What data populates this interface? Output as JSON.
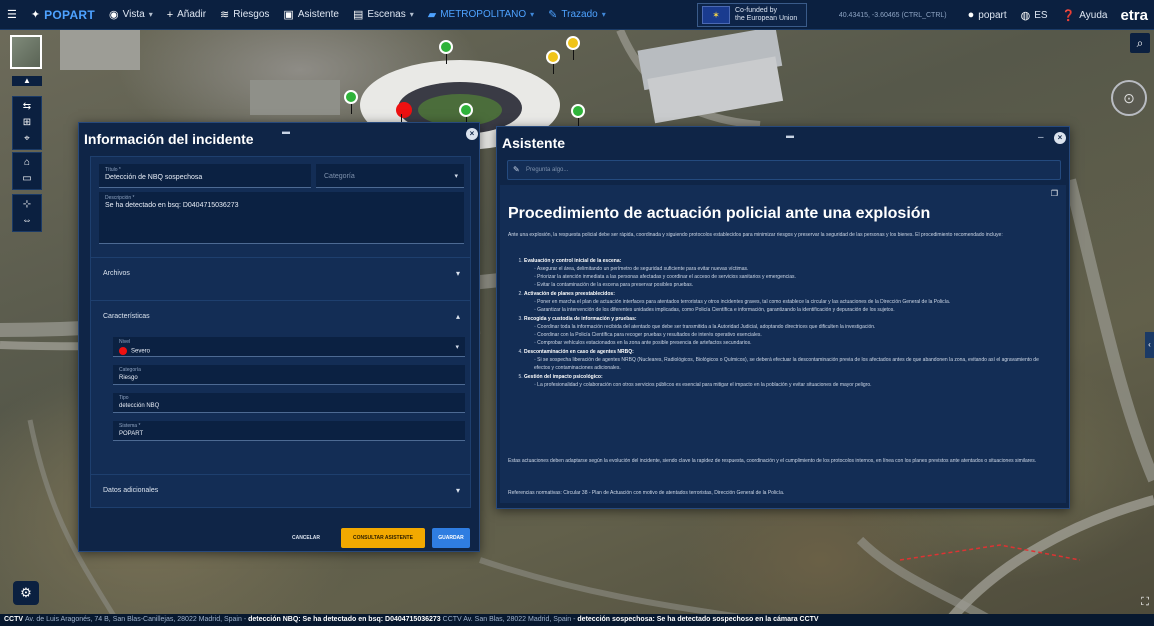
{
  "toolbar": {
    "brand": "POPART",
    "menus": [
      "Vista",
      "Añadir",
      "Riesgos",
      "Asistente",
      "Escenas"
    ],
    "layer_select": "METROPOLITANO",
    "draw_menu": "Trazado",
    "eu_text_1": "Co-funded by",
    "eu_text_2": "the European Union",
    "coords": "40.43415, -3.60465 (CTRL_CTRL)",
    "user": "popart",
    "lang": "ES",
    "help": "Ayuda",
    "logo": "etra"
  },
  "incident": {
    "title": "Información del incidente",
    "type_label": "Título *",
    "type_value": "Detección de NBQ sospechosa",
    "category_placeholder": "Categoría",
    "desc_label": "Descripción *",
    "desc_value": "Se ha detectado en bsq: D0404715036273",
    "section_files": "Archivos",
    "section_features": "Características",
    "severity_label": "Nivel",
    "severity_value": "Severo",
    "category_label": "Categoría",
    "category_value": "Riesgo",
    "subtype_label": "Tipo",
    "subtype_value": "detección NBQ",
    "origin_label": "Sistema *",
    "origin_value": "POPART",
    "section_extra": "Datos adicionales",
    "btn_cancel": "CANCELAR",
    "btn_assistant": "CONSULTAR ASISTENTE",
    "btn_save": "GUARDAR",
    "icons": {
      "close": "close-icon",
      "drag": "drag-handle-icon"
    }
  },
  "assistant": {
    "title": "Asistente",
    "ask_placeholder": "Pregunta algo...",
    "heading": "Procedimiento de actuación policial ante una explosión",
    "intro": "Ante una explosión, la respuesta policial debe ser rápida, coordinada y siguiendo protocolos establecidos para minimizar riesgos y preservar la seguridad de las personas y los bienes. El procedimiento recomendado incluye:",
    "steps": [
      {
        "title": "Evaluación y control inicial de la escena:",
        "items": [
          "Asegurar el área, delimitando un perímetro de seguridad suficiente para evitar nuevas víctimas.",
          "Priorizar la atención inmediata a las personas afectadas y coordinar el acceso de servicios sanitarios y emergencias.",
          "Evitar la contaminación de la escena para preservar posibles pruebas."
        ]
      },
      {
        "title": "Activación de planes preestablecidos:",
        "items": [
          "Poner en marcha el plan de actuación interfaces para atentados terroristas y otros incidentes graves, tal como establece la circular y las actuaciones de la Dirección General de la Policía.",
          "Garantizar la intervención de los diferentes unidades implicadas, como Policía Científica e información, garantizando la identificación y depuración de los sujetos."
        ]
      },
      {
        "title": "Recogida y custodia de información y pruebas:",
        "items": [
          "Coordinar toda la información recibida del atentado que debe ser transmitida a la Autoridad Judicial, adoptando directrices que dificulten la investigación.",
          "Coordinar con la Policía Científica para recoger pruebas y resultados de interés operativo esenciales.",
          "Comprobar vehículos estacionados en la zona ante posible presencia de artefactos secundarios."
        ]
      },
      {
        "title": "Descontaminación en caso de agentes NRBQ:",
        "items": [
          "Si se sospecha liberación de agentes NRBQ (Nucleares, Radiológicos, Biológicos o Químicos), se deberá efectuar la descontaminación previa de los afectados antes de que abandonen la zona, evitando así el agravamiento de efectos y contaminaciones adicionales."
        ]
      },
      {
        "title": "Gestión del impacto psicológico:",
        "items": [
          "La profesionalidad y colaboración con otros servicios públicos es esencial para mitigar el impacto en la población y evitar situaciones de mayor peligro."
        ]
      }
    ],
    "outro": "Estas actuaciones deben adaptarse según la evolución del incidente, siendo clave la rapidez de respuesta, coordinación y el cumplimiento de los protocolos internos, en línea con los planes previstos ante atentados o situaciones similares.",
    "refs": "Referencias normativas: Circular 38 - Plan de Actuación con motivo de atentados terroristas, Dirección General de la Policía."
  },
  "ticker": {
    "items": [
      {
        "place": "Av. de Luis Aragonés, 74 B, San Blas-Canillejas, 28022 Madrid, Spain -",
        "event": "detección NBQ: Se ha detectado en bsq: D0404715036273"
      },
      {
        "place": "CCTV Av. San Blas, 28022 Madrid, Spain -",
        "event": "detección sospechosa: Se ha detectado sospechoso en la cámara CCTV"
      }
    ],
    "prefix": "CCTV"
  },
  "map": {
    "accent": "#2fb33a",
    "alert": "#e11111",
    "warn": "#f0c419"
  }
}
